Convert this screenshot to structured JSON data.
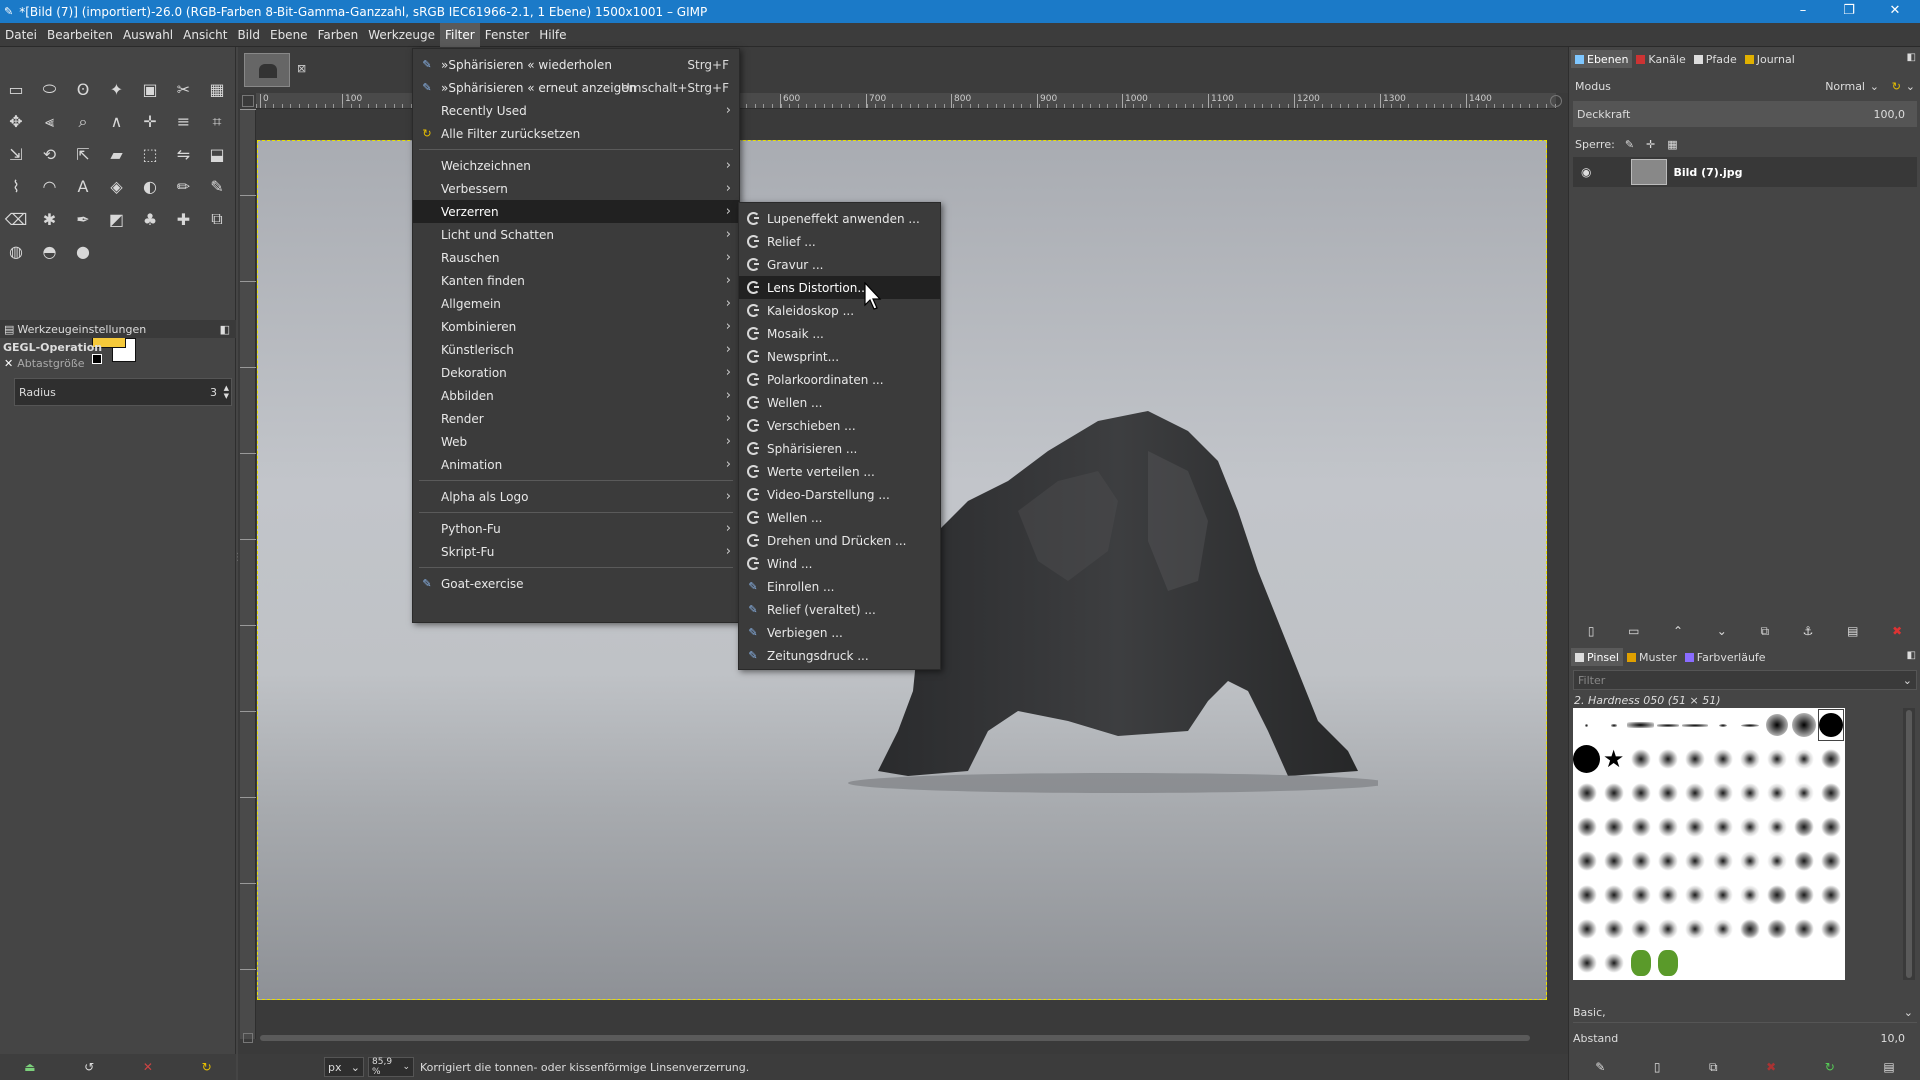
{
  "window": {
    "title": "*[Bild (7)] (importiert)-26.0 (RGB-Farben 8-Bit-Gamma-Ganzzahl, sRGB IEC61966-2.1, 1 Ebene) 1500x1001 – GIMP",
    "minimize": "–",
    "maximize": "❐",
    "close": "✕"
  },
  "menubar": [
    "Datei",
    "Bearbeiten",
    "Auswahl",
    "Ansicht",
    "Bild",
    "Ebene",
    "Farben",
    "Werkzeuge",
    "Filter",
    "Fenster",
    "Hilfe"
  ],
  "active_menu": "Filter",
  "filter_menu": {
    "top_items": [
      {
        "label": "»Sphärisieren « wiederholen",
        "accel": "Strg+F"
      },
      {
        "label": "»Sphärisieren « erneut anzeigen",
        "accel": "Umschalt+Strg+F"
      },
      {
        "label": "Recently Used",
        "submenu": true
      },
      {
        "label": "Alle Filter zurücksetzen"
      }
    ],
    "groups": [
      "Weichzeichnen",
      "Verbessern",
      "Verzerren",
      "Licht und Schatten",
      "Rauschen",
      "Kanten finden",
      "Allgemein",
      "Kombinieren",
      "Künstlerisch",
      "Dekoration",
      "Abbilden",
      "Render",
      "Web",
      "Animation"
    ],
    "highlighted": "Verzerren",
    "alpha": "Alpha als Logo",
    "script_items": [
      "Python-Fu",
      "Skript-Fu"
    ],
    "goat": "Goat-exercise"
  },
  "distort_submenu": {
    "items": [
      "Lupeneffekt anwenden ...",
      "Relief ...",
      "Gravur ...",
      "Lens Distortion...",
      "Kaleidoskop ...",
      "Mosaik ...",
      "Newsprint...",
      "Polarkoordinaten ...",
      "Wellen ...",
      "Verschieben ...",
      "Sphärisieren ...",
      "Werte verteilen ...",
      "Video-Darstellung ...",
      "Wellen ...",
      "Drehen und Drücken ...",
      "Wind ...",
      "Einrollen ...",
      "Relief (veraltet) ...",
      "Verbiegen ...",
      "Zeitungsdruck ..."
    ],
    "highlighted": "Lens Distortion..."
  },
  "toolbox": {
    "options_title": "Werkzeugeinstellungen",
    "operation": "GEGL-Operation",
    "sample_label": "Abtastgröße",
    "radius_label": "Radius",
    "radius_value": "3",
    "fg_color": "#f5c93a",
    "bg_color": "#ffffff"
  },
  "ruler": {
    "labels": [
      "0",
      "100",
      "600",
      "700",
      "800",
      "900",
      "1000",
      "1100",
      "1200",
      "1300",
      "1400"
    ]
  },
  "status": {
    "unit": "px",
    "zoom": "85,9 %",
    "message": "Korrigiert die tonnen- oder kissenförmige Linsenverzerrung."
  },
  "layers_panel": {
    "tabs": [
      "Ebenen",
      "Kanäle",
      "Pfade",
      "Journal"
    ],
    "mode_label": "Modus",
    "mode_value": "Normal",
    "opacity_label": "Deckkraft",
    "opacity_value": "100,0",
    "lock_label": "Sperre:",
    "layer_name": "Bild (7).jpg"
  },
  "brushes_panel": {
    "tabs": [
      "Pinsel",
      "Muster",
      "Farbverläufe"
    ],
    "filter_placeholder": "Filter",
    "brush_name": "2. Hardness 050 (51 × 51)",
    "preset": "Basic,",
    "spacing_label": "Abstand",
    "spacing_value": "10,0"
  },
  "colors": {
    "accent": "#1b7ac8",
    "menu_bg": "#3b3b3b",
    "menu_hl": "#212121",
    "selection": "#e8e000"
  }
}
